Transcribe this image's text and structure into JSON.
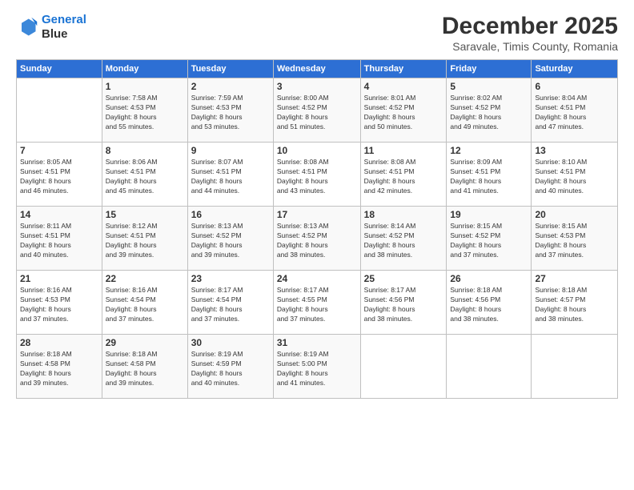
{
  "logo": {
    "line1": "General",
    "line2": "Blue"
  },
  "header": {
    "title": "December 2025",
    "subtitle": "Saravale, Timis County, Romania"
  },
  "days_of_week": [
    "Sunday",
    "Monday",
    "Tuesday",
    "Wednesday",
    "Thursday",
    "Friday",
    "Saturday"
  ],
  "weeks": [
    [
      {
        "day": "",
        "info": ""
      },
      {
        "day": "1",
        "info": "Sunrise: 7:58 AM\nSunset: 4:53 PM\nDaylight: 8 hours\nand 55 minutes."
      },
      {
        "day": "2",
        "info": "Sunrise: 7:59 AM\nSunset: 4:53 PM\nDaylight: 8 hours\nand 53 minutes."
      },
      {
        "day": "3",
        "info": "Sunrise: 8:00 AM\nSunset: 4:52 PM\nDaylight: 8 hours\nand 51 minutes."
      },
      {
        "day": "4",
        "info": "Sunrise: 8:01 AM\nSunset: 4:52 PM\nDaylight: 8 hours\nand 50 minutes."
      },
      {
        "day": "5",
        "info": "Sunrise: 8:02 AM\nSunset: 4:52 PM\nDaylight: 8 hours\nand 49 minutes."
      },
      {
        "day": "6",
        "info": "Sunrise: 8:04 AM\nSunset: 4:51 PM\nDaylight: 8 hours\nand 47 minutes."
      }
    ],
    [
      {
        "day": "7",
        "info": "Sunrise: 8:05 AM\nSunset: 4:51 PM\nDaylight: 8 hours\nand 46 minutes."
      },
      {
        "day": "8",
        "info": "Sunrise: 8:06 AM\nSunset: 4:51 PM\nDaylight: 8 hours\nand 45 minutes."
      },
      {
        "day": "9",
        "info": "Sunrise: 8:07 AM\nSunset: 4:51 PM\nDaylight: 8 hours\nand 44 minutes."
      },
      {
        "day": "10",
        "info": "Sunrise: 8:08 AM\nSunset: 4:51 PM\nDaylight: 8 hours\nand 43 minutes."
      },
      {
        "day": "11",
        "info": "Sunrise: 8:08 AM\nSunset: 4:51 PM\nDaylight: 8 hours\nand 42 minutes."
      },
      {
        "day": "12",
        "info": "Sunrise: 8:09 AM\nSunset: 4:51 PM\nDaylight: 8 hours\nand 41 minutes."
      },
      {
        "day": "13",
        "info": "Sunrise: 8:10 AM\nSunset: 4:51 PM\nDaylight: 8 hours\nand 40 minutes."
      }
    ],
    [
      {
        "day": "14",
        "info": "Sunrise: 8:11 AM\nSunset: 4:51 PM\nDaylight: 8 hours\nand 40 minutes."
      },
      {
        "day": "15",
        "info": "Sunrise: 8:12 AM\nSunset: 4:51 PM\nDaylight: 8 hours\nand 39 minutes."
      },
      {
        "day": "16",
        "info": "Sunrise: 8:13 AM\nSunset: 4:52 PM\nDaylight: 8 hours\nand 39 minutes."
      },
      {
        "day": "17",
        "info": "Sunrise: 8:13 AM\nSunset: 4:52 PM\nDaylight: 8 hours\nand 38 minutes."
      },
      {
        "day": "18",
        "info": "Sunrise: 8:14 AM\nSunset: 4:52 PM\nDaylight: 8 hours\nand 38 minutes."
      },
      {
        "day": "19",
        "info": "Sunrise: 8:15 AM\nSunset: 4:52 PM\nDaylight: 8 hours\nand 37 minutes."
      },
      {
        "day": "20",
        "info": "Sunrise: 8:15 AM\nSunset: 4:53 PM\nDaylight: 8 hours\nand 37 minutes."
      }
    ],
    [
      {
        "day": "21",
        "info": "Sunrise: 8:16 AM\nSunset: 4:53 PM\nDaylight: 8 hours\nand 37 minutes."
      },
      {
        "day": "22",
        "info": "Sunrise: 8:16 AM\nSunset: 4:54 PM\nDaylight: 8 hours\nand 37 minutes."
      },
      {
        "day": "23",
        "info": "Sunrise: 8:17 AM\nSunset: 4:54 PM\nDaylight: 8 hours\nand 37 minutes."
      },
      {
        "day": "24",
        "info": "Sunrise: 8:17 AM\nSunset: 4:55 PM\nDaylight: 8 hours\nand 37 minutes."
      },
      {
        "day": "25",
        "info": "Sunrise: 8:17 AM\nSunset: 4:56 PM\nDaylight: 8 hours\nand 38 minutes."
      },
      {
        "day": "26",
        "info": "Sunrise: 8:18 AM\nSunset: 4:56 PM\nDaylight: 8 hours\nand 38 minutes."
      },
      {
        "day": "27",
        "info": "Sunrise: 8:18 AM\nSunset: 4:57 PM\nDaylight: 8 hours\nand 38 minutes."
      }
    ],
    [
      {
        "day": "28",
        "info": "Sunrise: 8:18 AM\nSunset: 4:58 PM\nDaylight: 8 hours\nand 39 minutes."
      },
      {
        "day": "29",
        "info": "Sunrise: 8:18 AM\nSunset: 4:58 PM\nDaylight: 8 hours\nand 39 minutes."
      },
      {
        "day": "30",
        "info": "Sunrise: 8:19 AM\nSunset: 4:59 PM\nDaylight: 8 hours\nand 40 minutes."
      },
      {
        "day": "31",
        "info": "Sunrise: 8:19 AM\nSunset: 5:00 PM\nDaylight: 8 hours\nand 41 minutes."
      },
      {
        "day": "",
        "info": ""
      },
      {
        "day": "",
        "info": ""
      },
      {
        "day": "",
        "info": ""
      }
    ]
  ]
}
